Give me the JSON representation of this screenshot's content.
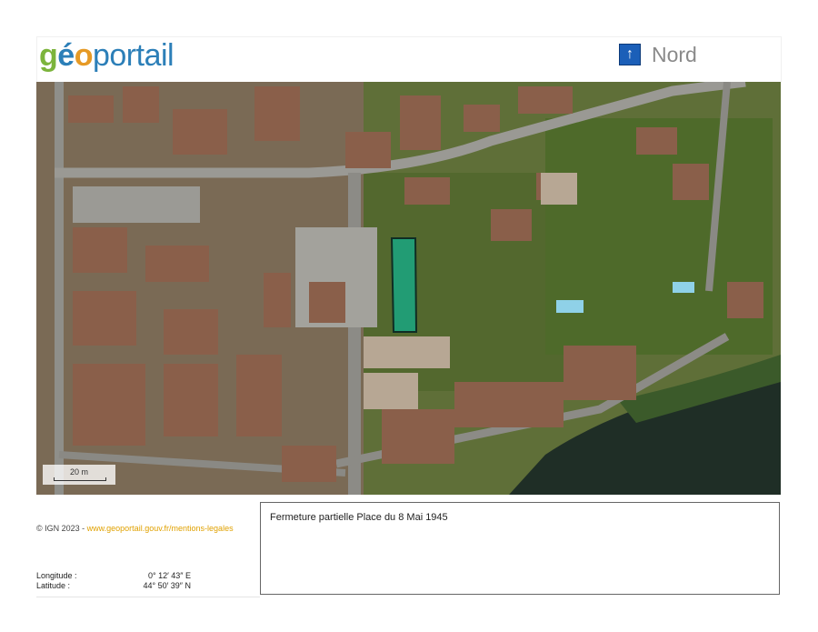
{
  "header": {
    "logo": {
      "part1": "g",
      "part2": "é",
      "part3": "o",
      "part4": "portail"
    },
    "north": {
      "arrow": "↑",
      "label": "Nord"
    }
  },
  "map": {
    "scale_label": "20 m",
    "highlight_color": "#1aa680"
  },
  "footer": {
    "copyright_prefix": "© IGN 2023 - ",
    "copyright_link": "www.geoportail.gouv.fr/mentions-legales",
    "longitude_label": "Longitude :",
    "longitude_value": "0° 12′ 43″ E",
    "latitude_label": "Latitude :",
    "latitude_value": "44° 50′ 39″ N"
  },
  "comment": {
    "text": "Fermeture partielle Place du 8 Mai 1945"
  },
  "colors": {
    "accent_blue": "#1b5fb8",
    "link_orange": "#e0a100",
    "logo_green": "#7cb43c"
  }
}
